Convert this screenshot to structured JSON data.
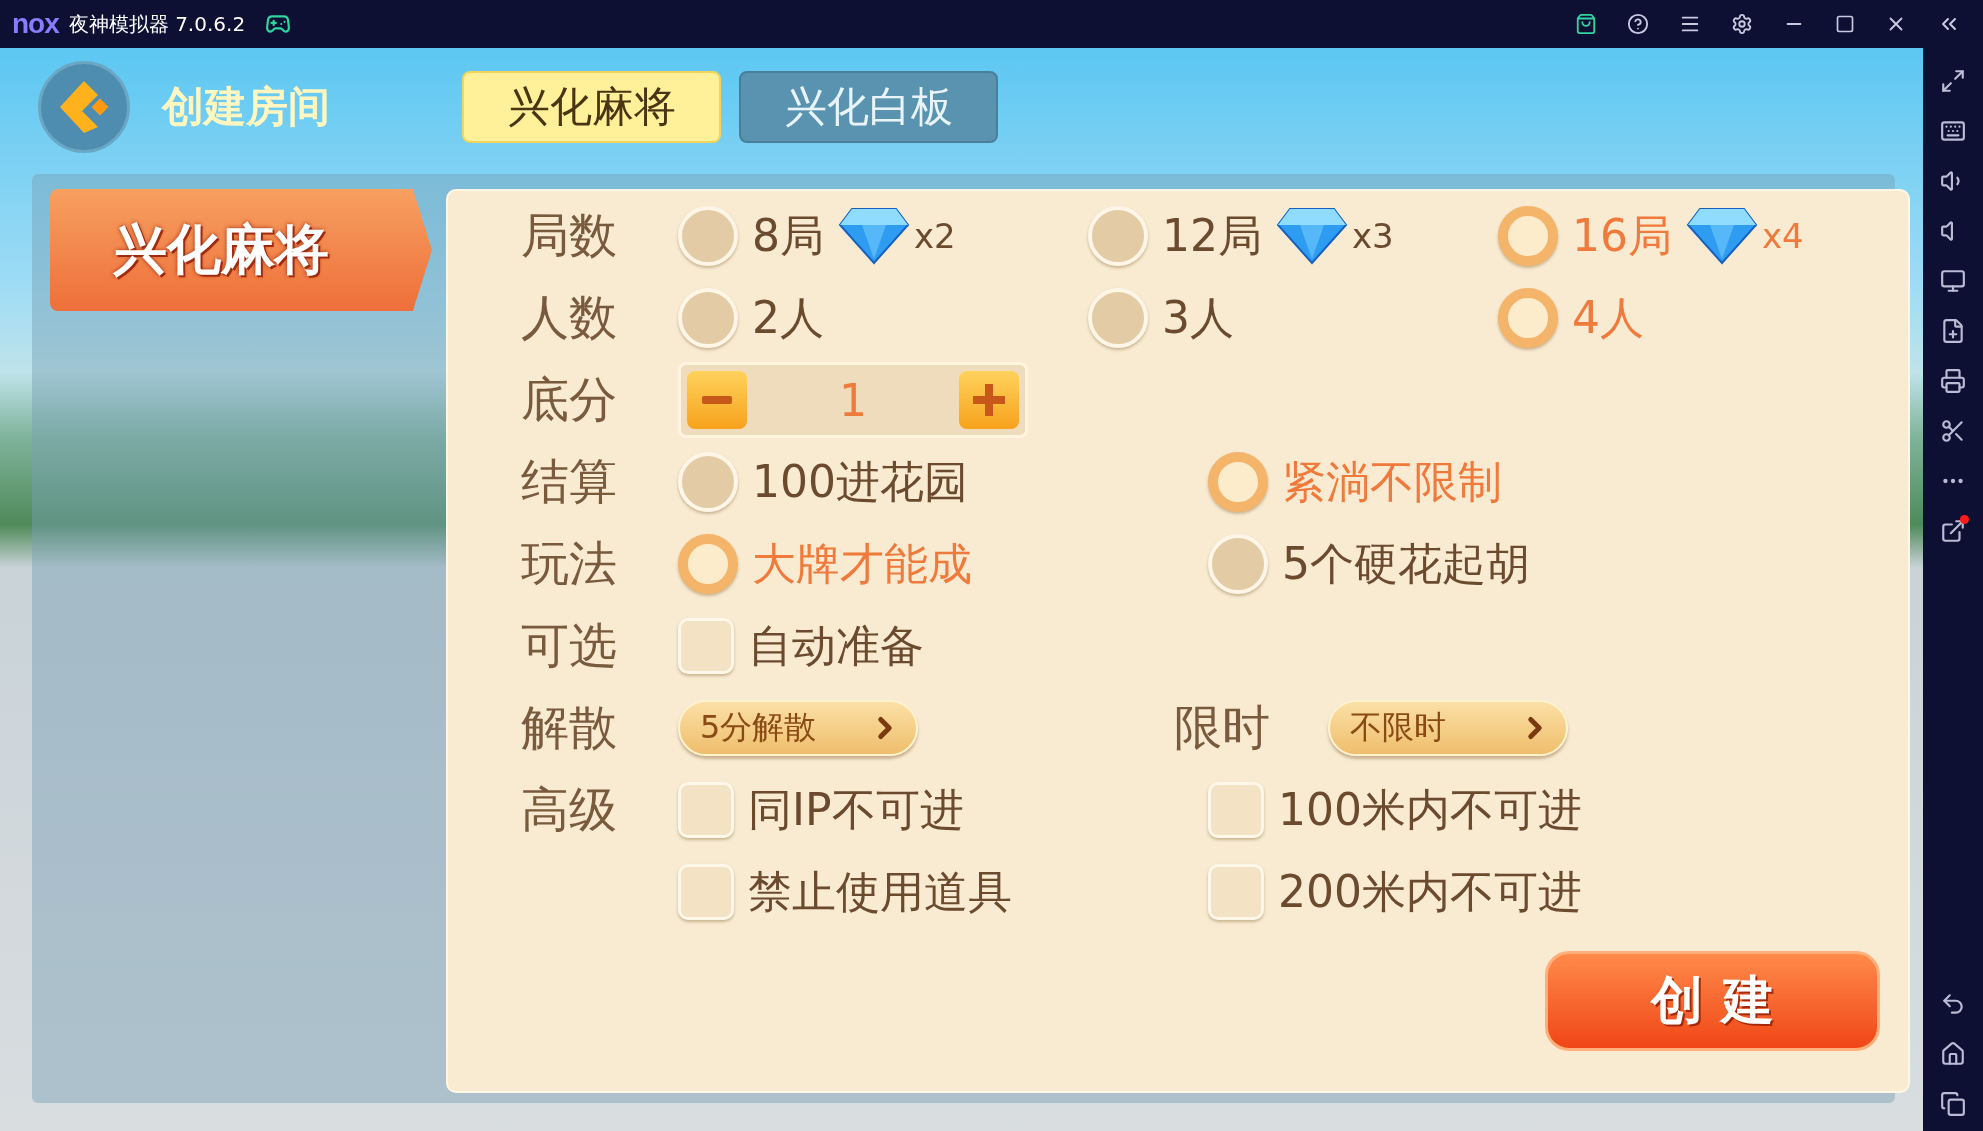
{
  "titlebar": {
    "logo": "nox",
    "title": "夜神模拟器 7.0.6.2"
  },
  "header": {
    "title": "创建房间",
    "tabs": [
      {
        "label": "兴化麻将",
        "selected": true
      },
      {
        "label": "兴化白板",
        "selected": false
      }
    ]
  },
  "game_tab": "兴化麻将",
  "rows": [
    {
      "label": "局数",
      "kind": "radio",
      "options": [
        {
          "text": "8局",
          "selected": false,
          "cost": "x2"
        },
        {
          "text": "12局",
          "selected": false,
          "cost": "x3"
        },
        {
          "text": "16局",
          "selected": true,
          "cost": "x4"
        }
      ]
    },
    {
      "label": "人数",
      "kind": "radio",
      "options": [
        {
          "text": "2人",
          "selected": false
        },
        {
          "text": "3人",
          "selected": false
        },
        {
          "text": "4人",
          "selected": true
        }
      ]
    },
    {
      "label": "底分",
      "kind": "stepper",
      "value": "1"
    },
    {
      "label": "结算",
      "kind": "radio",
      "options": [
        {
          "text": "100进花园",
          "selected": false
        },
        {
          "text": "紧淌不限制",
          "selected": true
        }
      ]
    },
    {
      "label": "玩法",
      "kind": "radio",
      "options": [
        {
          "text": "大牌才能成",
          "selected": true
        },
        {
          "text": "5个硬花起胡",
          "selected": false
        }
      ]
    },
    {
      "label": "可选",
      "kind": "checkbox",
      "options": [
        {
          "text": "自动准备",
          "checked": false
        }
      ]
    },
    {
      "label": "解散",
      "kind": "dropdown",
      "value": "5分解散",
      "extra": {
        "label": "限时",
        "value": "不限时"
      }
    },
    {
      "label": "高级",
      "kind": "checkbox",
      "options": [
        {
          "text": "同IP不可进",
          "checked": false
        },
        {
          "text": "100米内不可进",
          "checked": false
        }
      ]
    },
    {
      "kind": "checkbox",
      "options": [
        {
          "text": "禁止使用道具",
          "checked": false
        },
        {
          "text": "200米内不可进",
          "checked": false
        }
      ]
    }
  ],
  "create_button": "创 建"
}
